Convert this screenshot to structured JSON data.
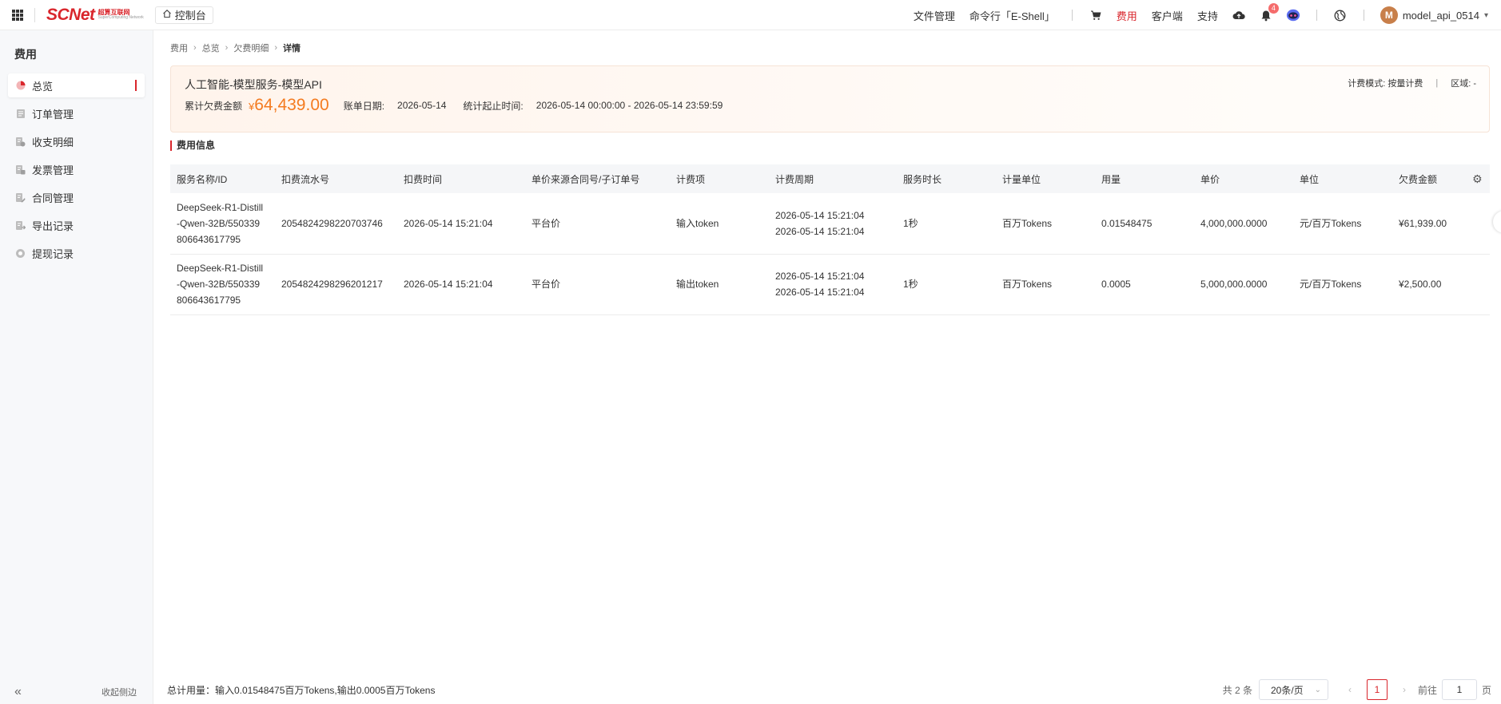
{
  "header": {
    "logo_text": "SCNet",
    "logo_sub_cn": "超算互联网",
    "logo_sub_en": "SuperComputing Network",
    "console_label": "控制台",
    "nav": {
      "file_manager": "文件管理",
      "eshell": "命令行「E-Shell」",
      "billing": "费用",
      "client": "客户端",
      "support": "支持"
    },
    "notification_count": "4",
    "avatar_letter": "M",
    "username": "model_api_0514"
  },
  "sidebar": {
    "title": "费用",
    "items": [
      {
        "label": "总览",
        "icon": "pie-chart-icon"
      },
      {
        "label": "订单管理",
        "icon": "order-icon"
      },
      {
        "label": "收支明细",
        "icon": "ledger-icon"
      },
      {
        "label": "发票管理",
        "icon": "invoice-icon"
      },
      {
        "label": "合同管理",
        "icon": "contract-icon"
      },
      {
        "label": "导出记录",
        "icon": "export-icon"
      },
      {
        "label": "提现记录",
        "icon": "withdraw-icon"
      }
    ],
    "collapse_label": "收起侧边"
  },
  "breadcrumb": [
    "费用",
    "总览",
    "欠费明细",
    "详情"
  ],
  "summary": {
    "title": "人工智能-模型服务-模型API",
    "total_label": "累计欠费金额",
    "total_currency": "¥",
    "total_amount": "64,439.00",
    "bill_date_label": "账单日期:",
    "bill_date": "2026-05-14",
    "period_label": "统计起止时间:",
    "period": "2026-05-14 00:00:00 - 2026-05-14 23:59:59",
    "billing_mode": "计费模式:  按量计费",
    "region": "区域:  -"
  },
  "section_title": "费用信息",
  "table": {
    "columns": [
      "服务名称/ID",
      "扣费流水号",
      "扣费时间",
      "单价来源合同号/子订单号",
      "计费项",
      "计费周期",
      "服务时长",
      "计量单位",
      "用量",
      "单价",
      "单位",
      "欠费金额"
    ],
    "rows": [
      {
        "name_l1": "DeepSeek-R1-Distill",
        "name_l2": "-Qwen-32B/550339",
        "name_l3": "806643617795",
        "serial": "2054824298220703746",
        "time": "2026-05-14 15:21:04",
        "price_source": "平台价",
        "item": "输入token",
        "period_start": "2026-05-14 15:21:04",
        "period_end": "2026-05-14 15:21:04",
        "duration": "1秒",
        "measure_unit": "百万Tokens",
        "usage": "0.01548475",
        "unit_price": "4,000,000.0000",
        "unit": "元/百万Tokens",
        "amount": "¥61,939.00"
      },
      {
        "name_l1": "DeepSeek-R1-Distill",
        "name_l2": "-Qwen-32B/550339",
        "name_l3": "806643617795",
        "serial": "2054824298296201217",
        "time": "2026-05-14 15:21:04",
        "price_source": "平台价",
        "item": "输出token",
        "period_start": "2026-05-14 15:21:04",
        "period_end": "2026-05-14 15:21:04",
        "duration": "1秒",
        "measure_unit": "百万Tokens",
        "usage": "0.0005",
        "unit_price": "5,000,000.0000",
        "unit": "元/百万Tokens",
        "amount": "¥2,500.00"
      }
    ]
  },
  "footer": {
    "total_usage": "总计用量：输入0.01548475百万Tokens,输出0.0005百万Tokens",
    "total_count": "共 2 条",
    "page_size": "20条/页",
    "current_page": "1",
    "goto_label": "前往",
    "goto_value": "1",
    "page_suffix": "页"
  },
  "colors": {
    "brand": "#d9262c",
    "amount": "#f47b20"
  }
}
